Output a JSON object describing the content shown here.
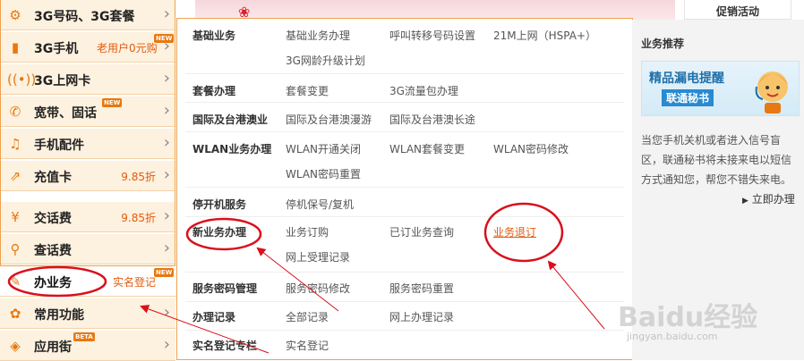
{
  "sidebar": {
    "items": [
      {
        "label": "3G号码、3G套餐",
        "icon": "gear-icon"
      },
      {
        "label": "3G手机",
        "sub": "老用户0元购",
        "badge": "NEW",
        "icon": "phone-icon"
      },
      {
        "label": "3G上网卡",
        "icon": "wireless-icon"
      },
      {
        "label": "宽带、固话",
        "badge": "NEW",
        "icon": "telephone-icon"
      },
      {
        "label": "手机配件",
        "icon": "headphones-icon"
      },
      {
        "label": "充值卡",
        "price": "9.85折",
        "icon": "card-icon"
      },
      {
        "label": "交话费",
        "price": "9.85折",
        "icon": "yen-icon"
      },
      {
        "label": "查话费",
        "icon": "magnifier-icon"
      },
      {
        "label": "办业务",
        "sub": "实名登记",
        "badge": "NEW",
        "icon": "pen-icon"
      },
      {
        "label": "常用功能",
        "icon": "flower-icon"
      },
      {
        "label": "应用街",
        "badge": "BETA",
        "icon": "android-icon"
      }
    ]
  },
  "panel": {
    "rows": [
      {
        "title": "基础业务",
        "links": [
          "基础业务办理",
          "呼叫转移号码设置",
          "21M上网（HSPA+）",
          "3G网龄升级计划"
        ]
      },
      {
        "title": "套餐办理",
        "links": [
          "套餐变更",
          "3G流量包办理"
        ]
      },
      {
        "title": "国际及台港澳业",
        "links": [
          "国际及台港澳漫游",
          "国际及台港澳长途"
        ]
      },
      {
        "title": "WLAN业务办理",
        "links": [
          "WLAN开通关闭",
          "WLAN套餐变更",
          "WLAN密码修改",
          "WLAN密码重置"
        ]
      },
      {
        "title": "停开机服务",
        "links": [
          "停机保号/复机"
        ]
      },
      {
        "title": "新业务办理",
        "links": [
          "业务订购",
          "已订业务查询",
          "业务退订",
          "网上受理记录"
        ]
      },
      {
        "title": "服务密码管理",
        "links": [
          "服务密码修改",
          "服务密码重置"
        ]
      },
      {
        "title": "办理记录",
        "links": [
          "全部记录",
          "网上办理记录"
        ]
      },
      {
        "title": "实名登记专栏",
        "links": [
          "实名登记"
        ]
      }
    ]
  },
  "promo_tab": "促销活动",
  "recommend": {
    "title": "业务推荐",
    "banner_line1": "精品漏电提醒",
    "banner_line2": "联通秘书",
    "description": "当您手机关机或者进入信号盲区，联通秘书将未接来电以短信方式通知您，帮您不错失来电。",
    "action": "立即办理"
  },
  "watermark": {
    "main": "Baidu经验",
    "url": "jingyan.baidu.com"
  },
  "colors": {
    "accent": "#e35a0e",
    "frame": "#f0a24f",
    "annotation": "#d9101c"
  }
}
